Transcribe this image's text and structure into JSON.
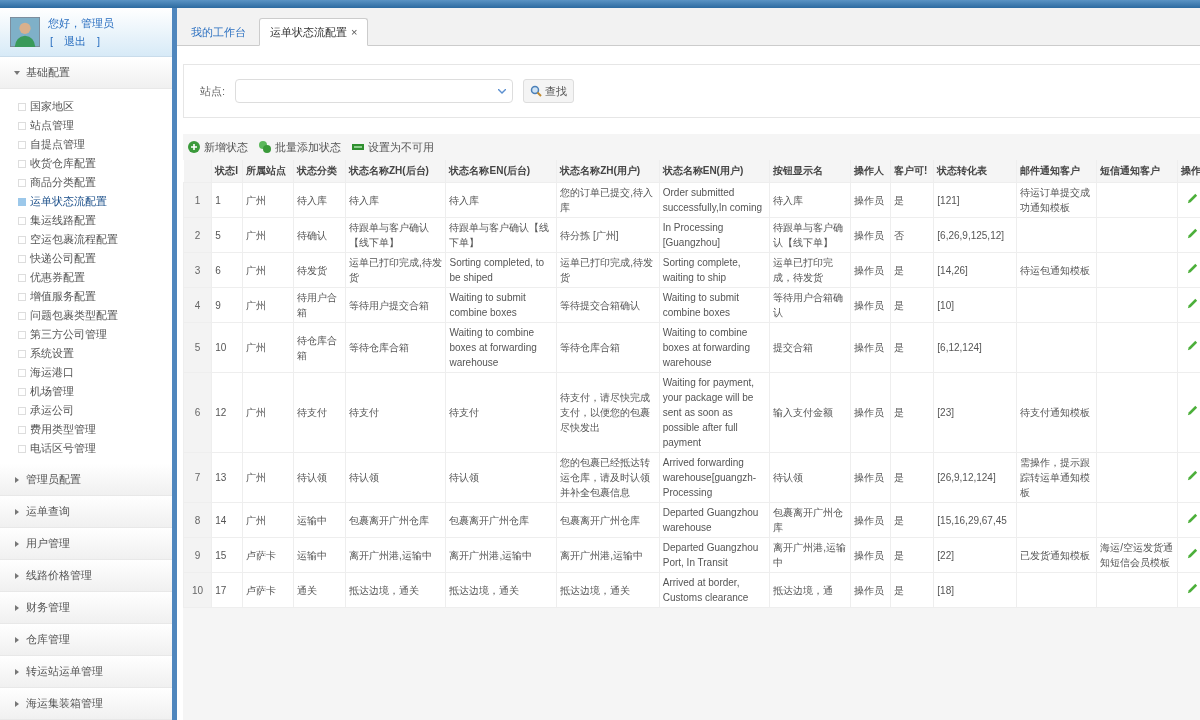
{
  "user": {
    "greeting": "您好，管理员",
    "logout": "[　退出　]"
  },
  "sidebar": {
    "groups": [
      {
        "label": "基础配置",
        "expanded": true,
        "children": [
          {
            "label": "国家地区",
            "selected": false
          },
          {
            "label": "站点管理",
            "selected": false
          },
          {
            "label": "自提点管理",
            "selected": false
          },
          {
            "label": "收货仓库配置",
            "selected": false
          },
          {
            "label": "商品分类配置",
            "selected": false
          },
          {
            "label": "运单状态流配置",
            "selected": true
          },
          {
            "label": "集运线路配置",
            "selected": false
          },
          {
            "label": "空运包裹流程配置",
            "selected": false
          },
          {
            "label": "快递公司配置",
            "selected": false
          },
          {
            "label": "优惠券配置",
            "selected": false
          },
          {
            "label": "增值服务配置",
            "selected": false
          },
          {
            "label": "问题包裹类型配置",
            "selected": false
          },
          {
            "label": "第三方公司管理",
            "selected": false
          },
          {
            "label": "系统设置",
            "selected": false
          },
          {
            "label": "海运港口",
            "selected": false
          },
          {
            "label": "机场管理",
            "selected": false
          },
          {
            "label": "承运公司",
            "selected": false
          },
          {
            "label": "费用类型管理",
            "selected": false
          },
          {
            "label": "电话区号管理",
            "selected": false
          }
        ]
      },
      {
        "label": "管理员配置",
        "expanded": false
      },
      {
        "label": "运单查询",
        "expanded": false
      },
      {
        "label": "用户管理",
        "expanded": false
      },
      {
        "label": "线路价格管理",
        "expanded": false
      },
      {
        "label": "财务管理",
        "expanded": false
      },
      {
        "label": "仓库管理",
        "expanded": false
      },
      {
        "label": "转运站运单管理",
        "expanded": false
      },
      {
        "label": "海运集装箱管理",
        "expanded": false
      }
    ]
  },
  "tabs": [
    {
      "label": "我的工作台",
      "selected": false
    },
    {
      "label": "运单状态流配置",
      "selected": true,
      "close": "×"
    }
  ],
  "search": {
    "label": "站点:",
    "button": "查找"
  },
  "toolbar": [
    {
      "label": "新增状态",
      "kind": "add"
    },
    {
      "label": "批量添加状态",
      "kind": "batch"
    },
    {
      "label": "设置为不可用",
      "kind": "disable"
    }
  ],
  "table": {
    "columns": [
      "状态I",
      "所属站点",
      "状态分类",
      "状态名称ZH(后台)",
      "状态名称EN(后台)",
      "状态名称ZH(用户)",
      "状态名称EN(用户)",
      "按钮显示名",
      "操作人",
      "客户可!",
      "状态转化表",
      "邮件通知客户",
      "短信通知客户",
      "操作"
    ],
    "rows": [
      {
        "num": "1",
        "cells": [
          "1",
          "广州",
          "待入库",
          "待入库",
          "待入库",
          "您的订单已提交,待入库",
          "Order submitted successfully,In coming",
          "待入库",
          "操作员",
          "是",
          "[121]",
          "待运订单提交成功通知模板",
          ""
        ]
      },
      {
        "num": "2",
        "cells": [
          "5",
          "广州",
          "待确认",
          "待跟单与客户确认【线下单】",
          "待跟单与客户确认【线下单】",
          "待分拣 [广州]",
          "In Processing [Guangzhou]",
          "待跟单与客户确认【线下单】",
          "操作员",
          "否",
          "[6,26,9,125,12]",
          "",
          ""
        ]
      },
      {
        "num": "3",
        "cells": [
          "6",
          "广州",
          "待发货",
          "运单已打印完成,待发货",
          "Sorting completed, to be shiped",
          "运单已打印完成,待发货",
          "Sorting complete, waiting to ship",
          "运单已打印完成，待发货",
          "操作员",
          "是",
          "[14,26]",
          "待运包通知模板",
          ""
        ]
      },
      {
        "num": "4",
        "cells": [
          "9",
          "广州",
          "待用户合箱",
          "等待用户提交合箱",
          "Waiting to submit combine boxes",
          "等待提交合箱确认",
          "Waiting to submit combine boxes",
          "等待用户合箱确认",
          "操作员",
          "是",
          "[10]",
          "",
          ""
        ]
      },
      {
        "num": "5",
        "cells": [
          "10",
          "广州",
          "待仓库合箱",
          "等待仓库合箱",
          "Waiting to combine boxes at forwarding warehouse",
          "等待仓库合箱",
          "Waiting to combine boxes at forwarding warehouse",
          "提交合箱",
          "操作员",
          "是",
          "[6,12,124]",
          "",
          ""
        ]
      },
      {
        "num": "6",
        "cells": [
          "12",
          "广州",
          "待支付",
          "待支付",
          "待支付",
          "待支付，请尽快完成支付，以便您的包裹尽快发出",
          "Waiting for payment, your package will be sent as soon as possible after full payment",
          "输入支付金额",
          "操作员",
          "是",
          "[23]",
          "待支付通知模板",
          ""
        ]
      },
      {
        "num": "7",
        "cells": [
          "13",
          "广州",
          "待认领",
          "待认领",
          "待认领",
          "您的包裹已经抵达转运仓库，请及时认领并补全包裹信息",
          "Arrived forwarding warehouse[guangzh- Processing",
          "待认领",
          "操作员",
          "是",
          "[26,9,12,124]",
          "需操作，提示跟踪转运单通知模板",
          ""
        ]
      },
      {
        "num": "8",
        "cells": [
          "14",
          "广州",
          "运输中",
          "包裹离开广州仓库",
          "包裹离开广州仓库",
          "包裹离开广州仓库",
          "Departed Guangzhou warehouse",
          "包裹离开广州仓库",
          "操作员",
          "是",
          "[15,16,29,67,45",
          "",
          ""
        ]
      },
      {
        "num": "9",
        "cells": [
          "15",
          "卢萨卡",
          "运输中",
          "离开广州港,运输中",
          "离开广州港,运输中",
          "离开广州港,运输中",
          "Departed Guangzhou Port, In Transit",
          "离开广州港,运输中",
          "操作员",
          "是",
          "[22]",
          "已发货通知模板",
          "海运/空运发货通知短信会员模板"
        ]
      },
      {
        "num": "10",
        "cells": [
          "17",
          "卢萨卡",
          "通关",
          "抵达边境，通关",
          "抵达边境，通关",
          "抵达边境，通关",
          "Arrived at border, Customs clearance",
          "抵达边境，通",
          "操作员",
          "是",
          "[18]",
          "",
          ""
        ]
      }
    ]
  }
}
